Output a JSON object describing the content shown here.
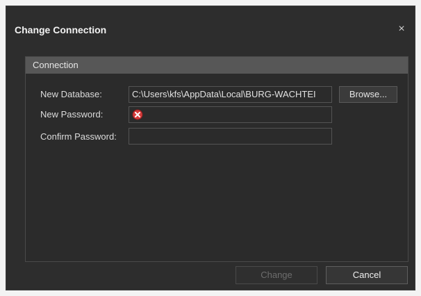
{
  "dialog": {
    "title": "Change Connection",
    "close_glyph": "×"
  },
  "group": {
    "title": "Connection",
    "fields": {
      "new_database": {
        "label": "New Database:",
        "value": "C:\\Users\\kfs\\AppData\\Local\\BURG-WACHTEI"
      },
      "new_password": {
        "label": "New Password:",
        "value": "",
        "status_icon": "error-icon"
      },
      "confirm_password": {
        "label": "Confirm Password:",
        "value": ""
      }
    },
    "browse_label": "Browse..."
  },
  "footer": {
    "change_label": "Change",
    "cancel_label": "Cancel"
  },
  "colors": {
    "background": "#2d2d2d",
    "group_header": "#575757",
    "error": "#d63b3b"
  }
}
